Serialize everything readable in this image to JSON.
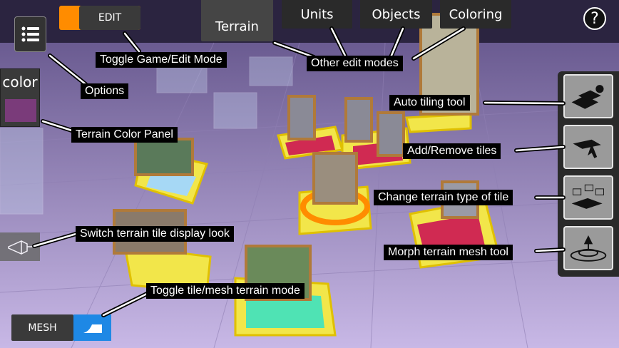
{
  "mode_toggle": {
    "mode_label": "EDIT"
  },
  "top_tabs": [
    {
      "label": "Terrain",
      "active": true
    },
    {
      "label": "Units",
      "active": false
    },
    {
      "label": "Objects",
      "active": false
    },
    {
      "label": "Coloring",
      "active": false
    }
  ],
  "help_button": {
    "label": "?"
  },
  "color_panel": {
    "label": "color",
    "swatch_color": "#7a3b7a"
  },
  "mesh_toggle": {
    "label": "MESH"
  },
  "annotations": {
    "toggle_mode": "Toggle Game/Edit Mode",
    "options": "Options",
    "other_modes": "Other edit modes",
    "color_panel": "Terrain Color Panel",
    "auto_tiling": "Auto tiling tool",
    "add_remove": "Add/Remove tiles",
    "change_type": "Change terrain type of tile",
    "switch_display": "Switch terrain tile display look",
    "morph": "Morph terrain mesh tool",
    "toggle_tile_mesh": "Toggle tile/mesh terrain mode"
  },
  "right_tools": [
    {
      "icon": "auto-tiling-icon"
    },
    {
      "icon": "add-remove-tile-icon"
    },
    {
      "icon": "change-terrain-type-icon"
    },
    {
      "icon": "morph-mesh-icon"
    }
  ],
  "colors": {
    "accent_orange": "#ff8c00",
    "accent_blue": "#1e88e5",
    "floor": "#b8a6d6"
  }
}
